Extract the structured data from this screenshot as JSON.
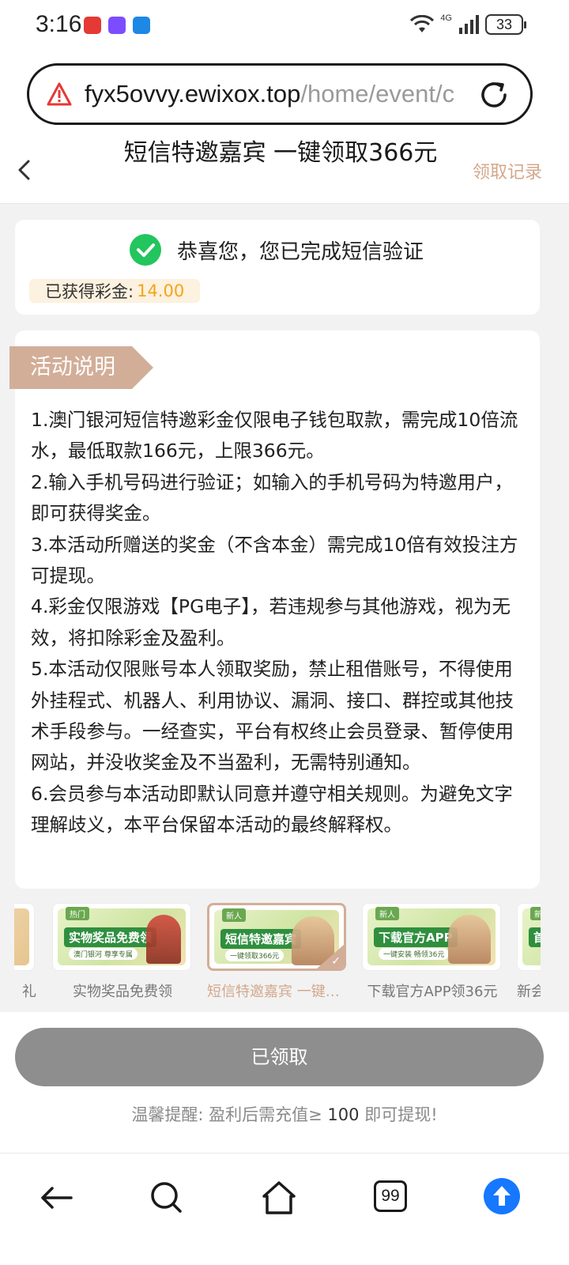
{
  "status_bar": {
    "time": "3:16",
    "network": "4G",
    "battery": "33"
  },
  "browser": {
    "url_host": "fyx5ovvy.ewixox.top",
    "url_path": "/home/event/c",
    "tabs_count": "99"
  },
  "header": {
    "title": "短信特邀嘉宾 一键领取366元",
    "records_link": "领取记录"
  },
  "success_card": {
    "message": "恭喜您，您已完成短信验证",
    "bonus_label": "已获得彩金:",
    "bonus_value": "14.00"
  },
  "rules": {
    "tag": "活动说明",
    "items": [
      "1.澳门银河短信特邀彩金仅限电子钱包取款，需完成10倍流水，最低取款166元，上限366元。",
      "2.输入手机号码进行验证；如输入的手机号码为特邀用户，即可获得奖金。",
      "3.本活动所赠送的奖金（不含本金）需完成10倍有效投注方可提现。",
      "4.彩金仅限游戏【PG电子】，若违规参与其他游戏，视为无效，将扣除彩金及盈利。",
      "5.本活动仅限账号本人领取奖励，禁止租借账号，不得使用外挂程式、机器人、利用协议、漏洞、接口、群控或其他技术手段参与。一经查实，平台有权终止会员登录、暂停使用网站，并没收奖金及不当盈利，无需特别通知。",
      "6.会员参与本活动即默认同意并遵守相关规则。为避免文字理解歧义，本平台保留本活动的最终解释权。"
    ]
  },
  "promos": [
    {
      "caption": "礼",
      "badge": "",
      "headline": "",
      "sub": ""
    },
    {
      "caption": "实物奖品免费领",
      "badge": "热门",
      "headline": "实物奖品免费领",
      "sub": "澳门银河 尊享专属"
    },
    {
      "caption": "短信特邀嘉宾 一键领取366元",
      "badge": "新人",
      "headline": "短信特邀嘉宾",
      "sub": "一键领取366元"
    },
    {
      "caption": "下载官方APP领36元",
      "badge": "新人",
      "headline": "下载官方APP",
      "sub": "一键安装 畅领36元"
    },
    {
      "caption": "新会",
      "badge": "新人",
      "headline": "首",
      "sub": ""
    }
  ],
  "actions": {
    "claim_button": "已领取",
    "tip_prefix": "温馨提醒: 盈利后需充值≥",
    "tip_amount": "100",
    "tip_suffix": "即可提现!"
  },
  "colors": {
    "accent": "#d2ae98",
    "bonus": "#f2a51a",
    "success": "#22c55e",
    "disabled_button": "#8e8e8e",
    "upload": "#1677ff"
  },
  "icons": [
    "warning-icon",
    "reload-icon",
    "chevron-left-icon",
    "check-circle-icon",
    "arrow-left-icon",
    "search-icon",
    "home-icon",
    "tabs-icon",
    "arrow-up-icon"
  ]
}
